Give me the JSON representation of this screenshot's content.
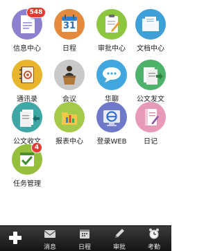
{
  "apps": [
    {
      "label": "信息中心",
      "badge": "548",
      "color": "#8e7fcf"
    },
    {
      "label": "日程",
      "color": "#e58a3c"
    },
    {
      "label": "审批中心",
      "color": "#8dc63f"
    },
    {
      "label": "文档中心",
      "color": "#3f9fd8"
    },
    {
      "label": "通讯录",
      "color": "#e9b52c"
    },
    {
      "label": "会议",
      "color": "#c9c9c9"
    },
    {
      "label": "华聊",
      "color": "#42a6df"
    },
    {
      "label": "公文发文",
      "color": "#4fb26a"
    },
    {
      "label": "公文收文",
      "color": "#3fa7a6"
    },
    {
      "label": "报表中心",
      "color": "#a5c94a"
    },
    {
      "label": "登录WEB",
      "color": "#6f79c9"
    },
    {
      "label": "日记",
      "color": "#e79ab8"
    },
    {
      "label": "任务管理",
      "badge": "4",
      "color": "#96bf3e"
    }
  ],
  "calendar_day": "31",
  "tabbar": {
    "tabs": [
      {
        "label": "消息"
      },
      {
        "label": "日程"
      },
      {
        "label": "审批"
      },
      {
        "label": "考勤"
      }
    ]
  }
}
